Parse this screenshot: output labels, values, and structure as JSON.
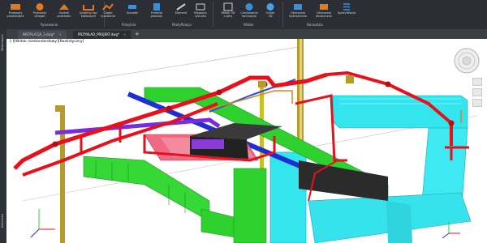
{
  "ribbon": {
    "buttons": [
      {
        "label": "Przewody\nprostokątne"
      },
      {
        "label": "Przewody\nokrągłe"
      },
      {
        "label": "Kształt\nprzewodu"
      },
      {
        "label": "Systemy kor.\nkablowych"
      },
      {
        "label": "Ciągłe\nrysowanie"
      },
      {
        "label": "Szczotki"
      },
      {
        "label": "Przekrój\npionowy"
      },
      {
        "label": "Element"
      },
      {
        "label": "Magazyn\nrysunku"
      },
      {
        "label": "Widok 3D\nz góry"
      },
      {
        "label": "Cieniowanie\nkoncepcja"
      },
      {
        "label": "Orbita\n3D"
      },
      {
        "label": "Obliczenia\nhydrauliczne"
      },
      {
        "label": "Obliczenia\nakustyczne"
      },
      {
        "label": "Specyfikacja"
      }
    ],
    "groups": [
      {
        "label": "Rysowanie"
      },
      {
        "label": "Przejścia"
      },
      {
        "label": "Modyfikacja"
      },
      {
        "label": "Widok"
      },
      {
        "label": "Narzędzia"
      }
    ]
  },
  "leftbar": {
    "top_label": "Właściwości",
    "bottom_label": "Biblioteka"
  },
  "tabs": [
    {
      "label": "INSTALACJA_3.dwg*",
      "active": false
    },
    {
      "label": "PRZYKŁAD_PROJEKT.dwg*",
      "active": true
    }
  ],
  "viewport": {
    "label": "[-][Widok niestandardowy][Realistyczny]"
  },
  "colors": {
    "pipe_red": "#e8101a",
    "duct_cyan": "#33e6ee",
    "duct_green": "#2fd12f",
    "column_olive": "#b59b2e",
    "pipe_purple": "#7a2be0",
    "pipe_blue": "#1d2ed6",
    "duct_pink": "#f06a86"
  }
}
